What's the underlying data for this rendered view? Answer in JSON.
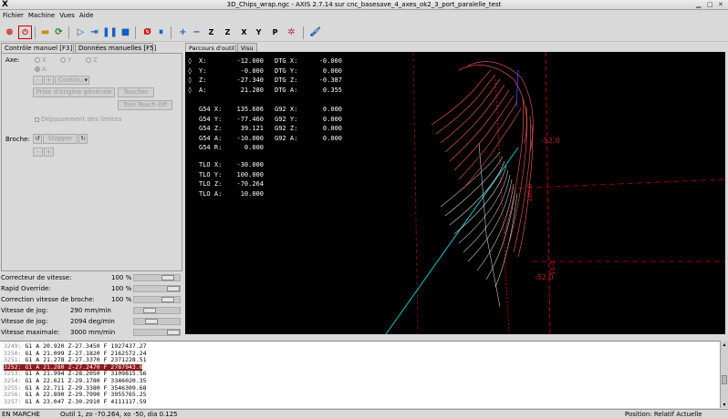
{
  "window": {
    "title": "3D_Chips_wrap.ngc - AXIS 2.7.14 sur cnc_basesave_4_axes_ok2_3_port_paralelle_test",
    "logo": "X"
  },
  "menu": [
    "Fichier",
    "Machine",
    "Vues",
    "Aide"
  ],
  "left_tabs": [
    "Contrôle manuel [F3]",
    "Données manuelles [F5]"
  ],
  "manual": {
    "axe_label": "Axe:",
    "axes": [
      "X",
      "Y",
      "Z",
      "A"
    ],
    "jog_minus": "-",
    "jog_plus": "+",
    "jog_mode": "Continu",
    "home_button": "Prise d'origine générale",
    "touch_button": "Toucher",
    "tool_touch_off": "Tool Touch Off",
    "limits_override": "Dépassement des limites",
    "spindle_label": "Broche:",
    "spindle_stop": "Stopper",
    "spindle_minus": "-",
    "spindle_plus": "+"
  },
  "sliders": [
    {
      "label": "Correcteur de vitesse:",
      "value": "100 %"
    },
    {
      "label": "Rapid Override:",
      "value": "100 %"
    },
    {
      "label": "Correction vitesse de broche:",
      "value": "100 %"
    },
    {
      "label": "Vitesse de jog:",
      "value": "290 mm/min"
    },
    {
      "label": "Vitesse de jog:",
      "value": "2094 deg/min"
    },
    {
      "label": "Vitesse maximale:",
      "value": "3000 mm/min"
    }
  ],
  "view_tabs": [
    "Parcours d'outil",
    "Visu"
  ],
  "dro": {
    "pos": [
      [
        "X:",
        "-12.000",
        "DTG X:",
        "-0.000"
      ],
      [
        "Y:",
        "-0.000",
        "DTG Y:",
        "0.000"
      ],
      [
        "Z:",
        "-27.340",
        "DTG Z:",
        "-0.387"
      ],
      [
        "A:",
        "21.280",
        "DTG A:",
        "0.355"
      ]
    ],
    "offsets": [
      [
        "G54 X:",
        "135.606",
        "G92 X:",
        "0.000"
      ],
      [
        "G54 Y:",
        "-77.460",
        "G92 Y:",
        "0.000"
      ],
      [
        "G54 Z:",
        "39.121",
        "G92 Z:",
        "0.000"
      ],
      [
        "G54 A:",
        "-10.000",
        "G92 A:",
        "0.000"
      ],
      [
        "G54 R:",
        "0.000",
        "",
        ""
      ]
    ],
    "tlo": [
      [
        "TLO X:",
        "-30.000"
      ],
      [
        "TLO Y:",
        "100.000"
      ],
      [
        "TLO Z:",
        "-70.264"
      ],
      [
        "TLO A:",
        "10.000"
      ]
    ]
  },
  "scene_labels": {
    "dim1": "-52.0",
    "dim2": "100.0",
    "dim3": "-52.0",
    "dim4": "10.0"
  },
  "gcode": [
    {
      "n": "3249:",
      "t": "G1 A 20.920 Z-27.3450 F 1927437.27"
    },
    {
      "n": "3250:",
      "t": "G1 A 21.099 Z-27.1820 F 2162572.24"
    },
    {
      "n": "3251:",
      "t": "G1 A 21.278 Z-27.3370 F 2371228.51"
    },
    {
      "n": "3252:",
      "t": "G1 A 21.280 Z-27.2470 F 2787943.88"
    },
    {
      "n": "3253:",
      "t": "G1 A 21.994 Z-28.2050 F 3109815.56"
    },
    {
      "n": "3254:",
      "t": "G1 A 22.621 Z-29.1780 F 3346020.35"
    },
    {
      "n": "3255:",
      "t": "G1 A 22.711 Z-29.3380 F 3546309.68"
    },
    {
      "n": "3256:",
      "t": "G1 A 22.890 Z-29.7990 F 3955765.25"
    },
    {
      "n": "3257:",
      "t": "G1 A 23.047 Z-30.2910 F 4111117.59"
    }
  ],
  "status": {
    "state": "EN MARCHE",
    "tool": "Outil 1, zo -70.264, xo -50, dia 0.125",
    "position": "Position: Relatif Actuelle"
  },
  "colors": {
    "toolpath": "#e05050",
    "feed": "#ffffff",
    "rapid": "#00c0c0",
    "limit": "#b00000",
    "selected_line": "#8b1a1a"
  }
}
